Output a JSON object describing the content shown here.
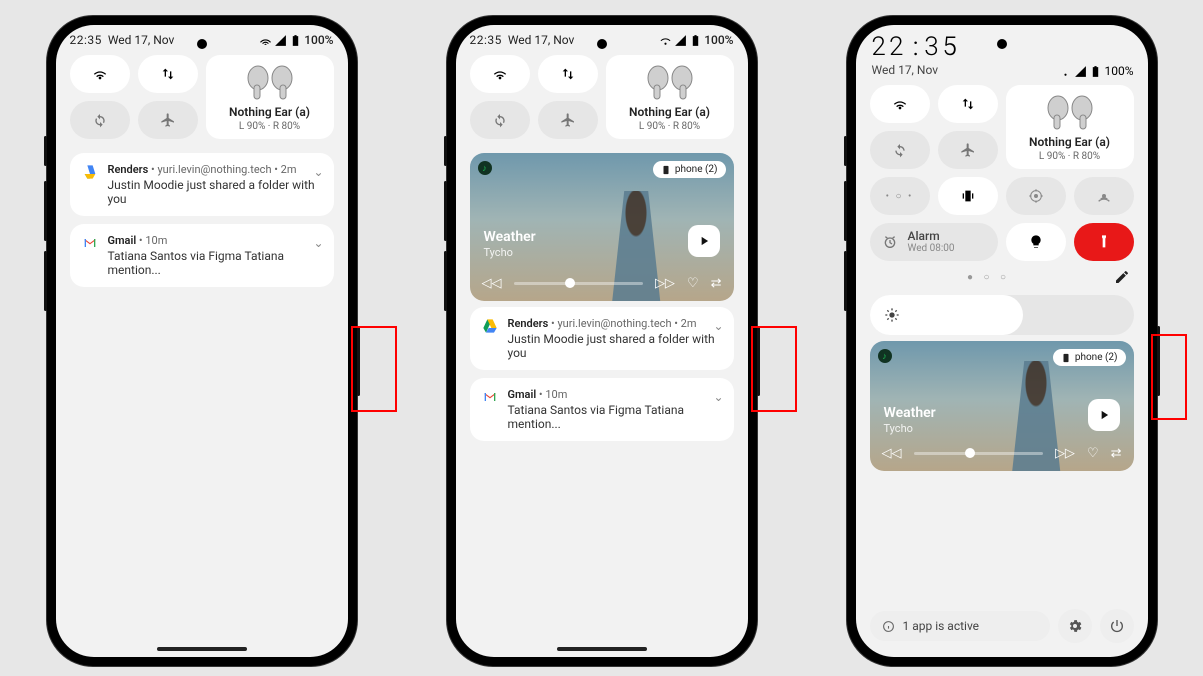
{
  "status": {
    "time": "22:35",
    "date": "Wed 17, Nov",
    "battery": "100%"
  },
  "earbuds": {
    "name": "Nothing Ear (а)",
    "levels": "L 90% · R 80%"
  },
  "media": {
    "device_label": "phone (2)",
    "title": "Weather",
    "artist": "Tycho"
  },
  "notifs": [
    {
      "app": "Renders",
      "meta": "yuri.levin@nothing.tech • 2m",
      "body": "Justin Moodie just shared a folder with you"
    },
    {
      "app": "Gmail",
      "meta": "10m",
      "body": "Tatiana Santos via Figma Tatiana mention..."
    }
  ],
  "alarm": {
    "label": "Alarm",
    "sub": "Wed 08:00"
  },
  "footer": {
    "active": "1 app is active"
  },
  "big": {
    "time": "22:35",
    "date": "Wed 17, Nov"
  }
}
